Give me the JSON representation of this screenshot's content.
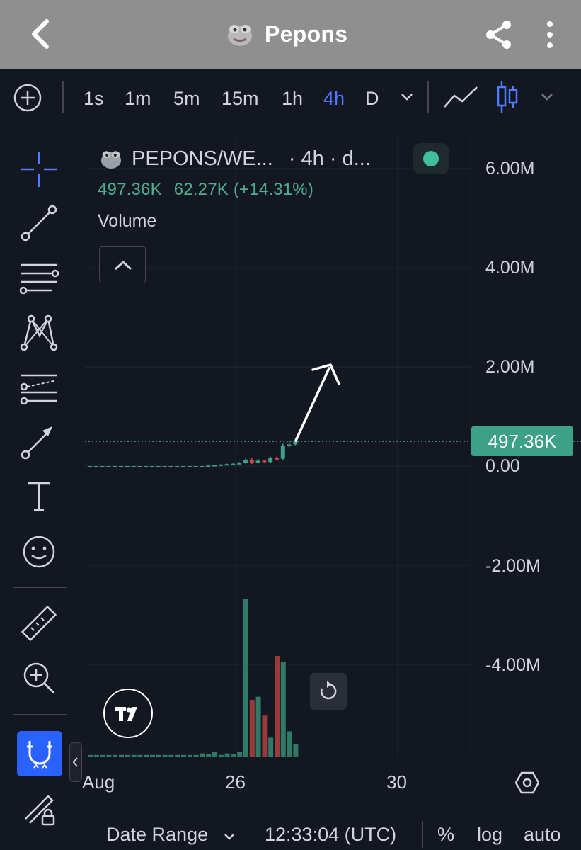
{
  "app": {
    "title": "Pepons"
  },
  "toolbar": {
    "timeframes": [
      "1s",
      "1m",
      "5m",
      "15m",
      "1h",
      "4h",
      "D"
    ],
    "active_timeframe": "4h"
  },
  "legend": {
    "symbol": "PEPONS/WE...",
    "interval": "· 4h · d...",
    "price": "497.36K",
    "change": "62.27K (+14.31%)",
    "indicator": "Volume"
  },
  "price_axis": {
    "labels": [
      "6.00M",
      "4.00M",
      "2.00M",
      "0.00",
      "-2.00M",
      "-4.00M"
    ],
    "last_price": "497.36K"
  },
  "time_axis": {
    "labels": [
      "Aug",
      "26",
      "30"
    ]
  },
  "bottom": {
    "date_range": "Date Range",
    "time": "12:33:04 (UTC)",
    "percent": "%",
    "log": "log",
    "auto": "auto"
  },
  "colors": {
    "up": "#3ca186",
    "down": "#c94a4a",
    "accent": "#2962ff",
    "background": "#131722"
  },
  "chart_data": {
    "type": "candlestick+volume",
    "title": "",
    "ylabel": "",
    "ylim": [
      -5200000,
      6200000
    ],
    "y_ticks": [
      6000000,
      4000000,
      2000000,
      0,
      -2000000,
      -4000000
    ],
    "x_labels": [
      "Aug",
      "26",
      "30"
    ],
    "last_price": 497360,
    "candles": [
      {
        "o": 0,
        "c": 0,
        "h": 0,
        "l": 0
      },
      {
        "o": 0,
        "c": 0,
        "h": 0,
        "l": 0
      },
      {
        "o": 0,
        "c": 0,
        "h": 0,
        "l": 0
      },
      {
        "o": 0,
        "c": 0,
        "h": 0,
        "l": 0
      },
      {
        "o": 0,
        "c": 0,
        "h": 0,
        "l": 0
      },
      {
        "o": 0,
        "c": 0,
        "h": 0,
        "l": 0
      },
      {
        "o": 0,
        "c": 0,
        "h": 0,
        "l": 0
      },
      {
        "o": 0,
        "c": 0,
        "h": 0,
        "l": 0
      },
      {
        "o": 0,
        "c": 0,
        "h": 0,
        "l": 0
      },
      {
        "o": 0,
        "c": 0,
        "h": 0,
        "l": 0
      },
      {
        "o": 0,
        "c": 0,
        "h": 0,
        "l": 0
      },
      {
        "o": 0,
        "c": 0,
        "h": 0,
        "l": 0
      },
      {
        "o": 0,
        "c": 0,
        "h": 0,
        "l": 0
      },
      {
        "o": 0,
        "c": 0,
        "h": 0,
        "l": 0
      },
      {
        "o": 0,
        "c": 0,
        "h": 0,
        "l": 0
      },
      {
        "o": 0,
        "c": 0,
        "h": 0,
        "l": 0
      },
      {
        "o": 0,
        "c": 0,
        "h": 0,
        "l": 0
      },
      {
        "o": 0,
        "c": 0,
        "h": 0,
        "l": 0
      },
      {
        "o": 0,
        "c": 0,
        "h": 0,
        "l": 0
      },
      {
        "o": 0,
        "c": 10000,
        "h": 12000,
        "l": 0
      },
      {
        "o": 10000,
        "c": 20000,
        "h": 25000,
        "l": 8000
      },
      {
        "o": 20000,
        "c": 30000,
        "h": 35000,
        "l": 15000
      },
      {
        "o": 30000,
        "c": 40000,
        "h": 50000,
        "l": 25000
      },
      {
        "o": 40000,
        "c": 45000,
        "h": 60000,
        "l": 35000
      },
      {
        "o": 45000,
        "c": 60000,
        "h": 80000,
        "l": 40000
      },
      {
        "o": 60000,
        "c": 120000,
        "h": 150000,
        "l": 50000
      },
      {
        "o": 120000,
        "c": 60000,
        "h": 160000,
        "l": 40000
      },
      {
        "o": 60000,
        "c": 110000,
        "h": 150000,
        "l": 50000
      },
      {
        "o": 110000,
        "c": 80000,
        "h": 130000,
        "l": 60000
      },
      {
        "o": 80000,
        "c": 160000,
        "h": 190000,
        "l": 70000
      },
      {
        "o": 160000,
        "c": 150000,
        "h": 190000,
        "l": 120000
      },
      {
        "o": 150000,
        "c": 410000,
        "h": 450000,
        "l": 130000
      },
      {
        "o": 410000,
        "c": 435000,
        "h": 520000,
        "l": 380000
      },
      {
        "o": 435000,
        "c": 497360,
        "h": 560000,
        "l": 420000
      }
    ],
    "volume_pct": [
      0.01,
      0.01,
      0.01,
      0.01,
      0.01,
      0.01,
      0.01,
      0.01,
      0.01,
      0.01,
      0.01,
      0.01,
      0.01,
      0.01,
      0.01,
      0.01,
      0.01,
      0.01,
      0.02,
      0.015,
      0.03,
      0.01,
      0.02,
      0.015,
      0.03,
      1.0,
      0.36,
      0.38,
      0.26,
      0.12,
      0.64,
      0.6,
      0.16,
      0.08
    ]
  }
}
